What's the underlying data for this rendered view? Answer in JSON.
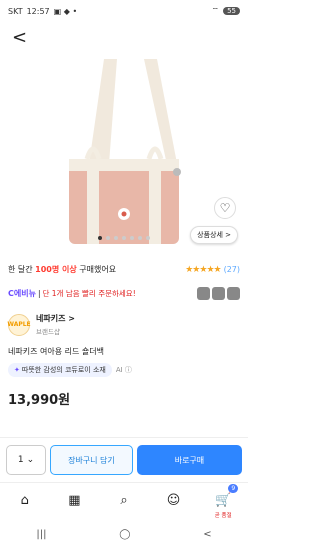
{
  "status_bar": {
    "carrier": "SKT",
    "time": "12:57",
    "battery": "55"
  },
  "gallery": {
    "dots": 7,
    "active_dot": 0,
    "detail_button": "상품상세 >"
  },
  "buyers": {
    "prefix": "한 달간 ",
    "count": "100명 이상",
    "suffix": " 구매했어요",
    "stars": "★★★★★",
    "reviews": "(27)"
  },
  "promo": {
    "brand": "C에비뉴",
    "message": "단 1개 남음 빨리 주문하세요!"
  },
  "store": {
    "logo": "WAPLE",
    "name": "네파키즈 >",
    "type": "브랜드샵"
  },
  "product": {
    "title": "네파키즈 여아용 리드 숄더백",
    "ai_pill": "따뜻한 감성의 코듀로이 소재",
    "ai_label": "AI ⓘ",
    "price": "13,990원"
  },
  "purchase": {
    "quantity": "1",
    "cart": "장바구니 담기",
    "buy": "바로구매"
  },
  "tabs": {
    "cart_badge": "9",
    "cart_caption": "곧 품절"
  },
  "colors": {
    "accent": "#2e86ff",
    "bag_body": "#e8b7a8",
    "strap": "#f1e9dd"
  }
}
